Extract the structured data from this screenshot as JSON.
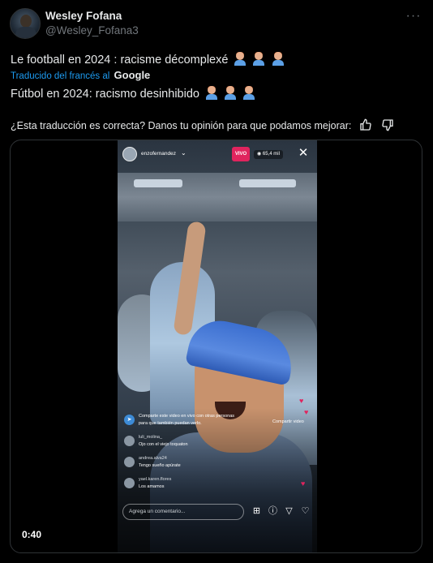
{
  "author": {
    "display_name": "Wesley Fofana",
    "handle": "@Wesley_Fofana3",
    "avatar_icon": "profile-photo"
  },
  "tweet": {
    "original_text": "Le football en 2024 : racisme décomplexé",
    "translated_label": "Traducido del francés al",
    "translator_brand": "Google",
    "translated_text": "Fútbol en 2024: racismo desinhibido",
    "emoji_name": "man-facepalming-light-skin-tone",
    "emoji_count": 3
  },
  "translation_feedback": {
    "question": "¿Esta traducción es correcta? Danos tu opinión para que podamos mejorar:",
    "like_icon": "thumbs-up-icon",
    "dislike_icon": "thumbs-down-icon"
  },
  "media": {
    "timestamp": "0:40",
    "instagram_live": {
      "username": "enzofernandez",
      "live_badge": "VIVO",
      "viewer_count": "65,4 mil",
      "comments": [
        {
          "type": "system",
          "text": "Comparte este video en vivo con otras personas",
          "text2": "para que también puedan verlo.",
          "cta": "Compartir video"
        },
        {
          "type": "comment",
          "user": "luli_molina_",
          "text": "Ojo con el viejo toquaton"
        },
        {
          "type": "comment",
          "user": "andrea.alva24",
          "text": "Tengo sueño apúrate"
        },
        {
          "type": "comment",
          "user": "yael.karen.flores",
          "text": "Los amamos"
        }
      ],
      "comment_placeholder": "Agrega un comentario..."
    }
  },
  "colors": {
    "background": "#000000",
    "text_primary": "#e7e9ea",
    "text_secondary": "#71767b",
    "link": "#1d9bf0",
    "border": "#2f3336",
    "live_red": "#e0245e"
  }
}
